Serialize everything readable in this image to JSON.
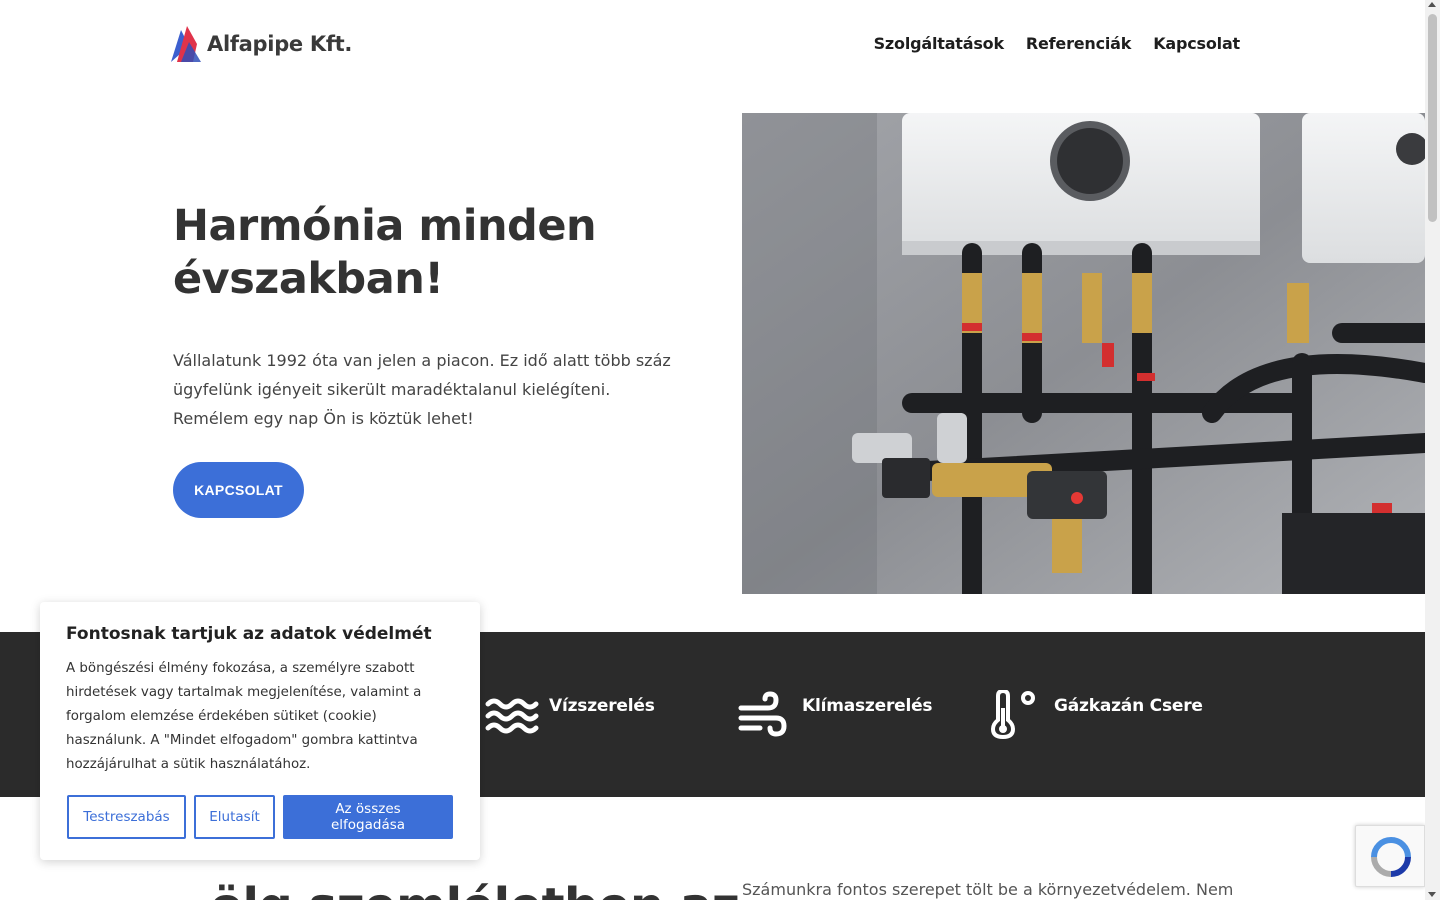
{
  "header": {
    "logo_text": "Alfapipe Kft.",
    "nav": [
      "Szolgáltatások",
      "Referenciák",
      "Kapcsolat"
    ]
  },
  "hero": {
    "title": "Harmónia minden évszakban!",
    "text": "Vállalatunk 1992 óta van jelen a piacon. Ez idő alatt több száz ügyfelünk igényeit sikerült maradéktalanul kielégíteni. Remélem egy nap Ön is köztük lehet!",
    "button": "KAPCSOLAT"
  },
  "services": [
    {
      "label": "Vízszerelés",
      "icon": "water-waves-icon"
    },
    {
      "label": "Klímaszerelés",
      "icon": "wind-icon"
    },
    {
      "label": "Gázkazán Csere",
      "icon": "thermometer-icon"
    }
  ],
  "bottom": {
    "heading_partial": "ölg szemléletben az",
    "text_partial": "Számunkra fontos szerepet tölt be a környezetvédelem. Nem"
  },
  "cookie": {
    "title": "Fontosnak tartjuk az adatok védelmét",
    "text": "A böngészési élmény fokozása, a személyre szabott hirdetések vagy tartalmak megjelenítése, valamint a forgalom elemzése érdekében sütiket (cookie) használunk. A \"Mindet elfogadom\" gombra kattintva hozzájárulhat a sütik használatához.",
    "customize": "Testreszabás",
    "reject": "Elutasít",
    "accept_all": "Az összes elfogadása"
  },
  "colors": {
    "accent": "#3c6fd8",
    "dark_band": "#2b2b2b"
  }
}
